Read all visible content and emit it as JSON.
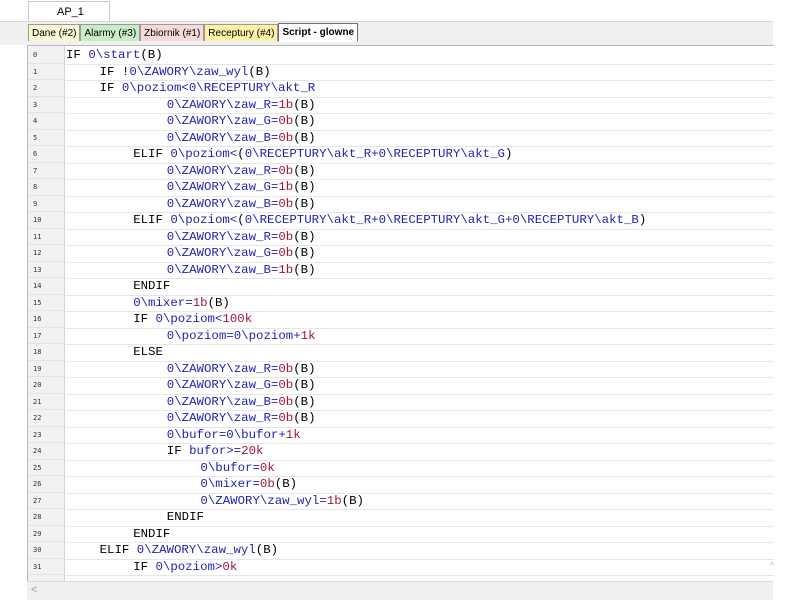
{
  "window_tab": "AP_1",
  "tabs": [
    {
      "label": "Dane (#2)",
      "color": "#f7f7d2",
      "active": false
    },
    {
      "label": "Alarmy (#3)",
      "color": "#c8ecc8",
      "active": false
    },
    {
      "label": "Zbiornik (#1)",
      "color": "#f6d9da",
      "active": false
    },
    {
      "label": "Receptury (#4)",
      "color": "#faf3a6",
      "active": false
    },
    {
      "label": "Script - glowne",
      "color": "#ffffff",
      "active": true
    }
  ],
  "colors": {
    "keyword": "#000000",
    "variable": "#1f1fb3",
    "number": "#a0153e"
  },
  "code_lines": [
    {
      "num": "0",
      "indent": 0,
      "tokens": [
        [
          "k",
          "IF "
        ],
        [
          "v",
          "0\\start"
        ],
        [
          "k",
          "(B)"
        ]
      ]
    },
    {
      "num": "1",
      "indent": 4,
      "tokens": [
        [
          "k",
          "IF "
        ],
        [
          "k",
          "!"
        ],
        [
          "v",
          "0\\ZAWORY\\zaw_wyl"
        ],
        [
          "k",
          "(B)"
        ]
      ]
    },
    {
      "num": "2",
      "indent": 4,
      "tokens": [
        [
          "k",
          "IF "
        ],
        [
          "v",
          "0\\poziom<0\\RECEPTURY\\akt_R"
        ]
      ]
    },
    {
      "num": "3",
      "indent": 12,
      "tokens": [
        [
          "v",
          "0\\ZAWORY\\zaw_R="
        ],
        [
          "n",
          "1b"
        ],
        [
          "k",
          "(B)"
        ]
      ]
    },
    {
      "num": "4",
      "indent": 12,
      "tokens": [
        [
          "v",
          "0\\ZAWORY\\zaw_G="
        ],
        [
          "n",
          "0b"
        ],
        [
          "k",
          "(B)"
        ]
      ]
    },
    {
      "num": "5",
      "indent": 12,
      "tokens": [
        [
          "v",
          "0\\ZAWORY\\zaw_B="
        ],
        [
          "n",
          "0b"
        ],
        [
          "k",
          "(B)"
        ]
      ]
    },
    {
      "num": "6",
      "indent": 8,
      "tokens": [
        [
          "k",
          "ELIF "
        ],
        [
          "v",
          "0\\poziom<"
        ],
        [
          "k",
          "("
        ],
        [
          "v",
          "0\\RECEPTURY\\akt_R+0\\RECEPTURY\\akt_G"
        ],
        [
          "k",
          ")"
        ]
      ]
    },
    {
      "num": "7",
      "indent": 12,
      "tokens": [
        [
          "v",
          "0\\ZAWORY\\zaw_R="
        ],
        [
          "n",
          "0b"
        ],
        [
          "k",
          "(B)"
        ]
      ]
    },
    {
      "num": "8",
      "indent": 12,
      "tokens": [
        [
          "v",
          "0\\ZAWORY\\zaw_G="
        ],
        [
          "n",
          "1b"
        ],
        [
          "k",
          "(B)"
        ]
      ]
    },
    {
      "num": "9",
      "indent": 12,
      "tokens": [
        [
          "v",
          "0\\ZAWORY\\zaw_B="
        ],
        [
          "n",
          "0b"
        ],
        [
          "k",
          "(B)"
        ]
      ]
    },
    {
      "num": "10",
      "indent": 8,
      "tokens": [
        [
          "k",
          "ELIF "
        ],
        [
          "v",
          "0\\poziom<"
        ],
        [
          "k",
          "("
        ],
        [
          "v",
          "0\\RECEPTURY\\akt_R+0\\RECEPTURY\\akt_G+0\\RECEPTURY\\akt_B"
        ],
        [
          "k",
          ")"
        ]
      ]
    },
    {
      "num": "11",
      "indent": 12,
      "tokens": [
        [
          "v",
          "0\\ZAWORY\\zaw_R="
        ],
        [
          "n",
          "0b"
        ],
        [
          "k",
          "(B)"
        ]
      ]
    },
    {
      "num": "12",
      "indent": 12,
      "tokens": [
        [
          "v",
          "0\\ZAWORY\\zaw_G="
        ],
        [
          "n",
          "0b"
        ],
        [
          "k",
          "(B)"
        ]
      ]
    },
    {
      "num": "13",
      "indent": 12,
      "tokens": [
        [
          "v",
          "0\\ZAWORY\\zaw_B="
        ],
        [
          "n",
          "1b"
        ],
        [
          "k",
          "(B)"
        ]
      ]
    },
    {
      "num": "14",
      "indent": 8,
      "tokens": [
        [
          "k",
          "ENDIF"
        ]
      ]
    },
    {
      "num": "15",
      "indent": 8,
      "tokens": [
        [
          "v",
          "0\\mixer="
        ],
        [
          "n",
          "1b"
        ],
        [
          "k",
          "(B)"
        ]
      ]
    },
    {
      "num": "16",
      "indent": 8,
      "tokens": [
        [
          "k",
          "IF "
        ],
        [
          "v",
          "0\\poziom<"
        ],
        [
          "n",
          "100k"
        ]
      ]
    },
    {
      "num": "17",
      "indent": 12,
      "tokens": [
        [
          "v",
          "0\\poziom=0\\poziom+"
        ],
        [
          "n",
          "1k"
        ]
      ]
    },
    {
      "num": "18",
      "indent": 8,
      "tokens": [
        [
          "k",
          "ELSE"
        ]
      ]
    },
    {
      "num": "19",
      "indent": 12,
      "tokens": [
        [
          "v",
          "0\\ZAWORY\\zaw_R="
        ],
        [
          "n",
          "0b"
        ],
        [
          "k",
          "(B)"
        ]
      ]
    },
    {
      "num": "20",
      "indent": 12,
      "tokens": [
        [
          "v",
          "0\\ZAWORY\\zaw_G="
        ],
        [
          "n",
          "0b"
        ],
        [
          "k",
          "(B)"
        ]
      ]
    },
    {
      "num": "21",
      "indent": 12,
      "tokens": [
        [
          "v",
          "0\\ZAWORY\\zaw_B="
        ],
        [
          "n",
          "0b"
        ],
        [
          "k",
          "(B)"
        ]
      ]
    },
    {
      "num": "22",
      "indent": 12,
      "tokens": [
        [
          "v",
          "0\\ZAWORY\\zaw_R="
        ],
        [
          "n",
          "0b"
        ],
        [
          "k",
          "(B)"
        ]
      ]
    },
    {
      "num": "23",
      "indent": 12,
      "tokens": [
        [
          "v",
          "0\\bufor=0\\bufor+"
        ],
        [
          "n",
          "1k"
        ]
      ]
    },
    {
      "num": "24",
      "indent": 12,
      "tokens": [
        [
          "k",
          "IF "
        ],
        [
          "v",
          "bufor>="
        ],
        [
          "n",
          "20k"
        ]
      ]
    },
    {
      "num": "25",
      "indent": 16,
      "tokens": [
        [
          "v",
          "0\\bufor="
        ],
        [
          "n",
          "0k"
        ]
      ]
    },
    {
      "num": "26",
      "indent": 16,
      "tokens": [
        [
          "v",
          "0\\mixer="
        ],
        [
          "n",
          "0b"
        ],
        [
          "k",
          "(B)"
        ]
      ]
    },
    {
      "num": "27",
      "indent": 16,
      "tokens": [
        [
          "v",
          "0\\ZAWORY\\zaw_wyl="
        ],
        [
          "n",
          "1b"
        ],
        [
          "k",
          "(B)"
        ]
      ]
    },
    {
      "num": "28",
      "indent": 12,
      "tokens": [
        [
          "k",
          "ENDIF"
        ]
      ]
    },
    {
      "num": "29",
      "indent": 8,
      "tokens": [
        [
          "k",
          "ENDIF"
        ]
      ]
    },
    {
      "num": "30",
      "indent": 4,
      "tokens": [
        [
          "k",
          "ELIF "
        ],
        [
          "v",
          "0\\ZAWORY\\zaw_wyl"
        ],
        [
          "k",
          "(B)"
        ]
      ]
    },
    {
      "num": "31",
      "indent": 8,
      "tokens": [
        [
          "k",
          "IF "
        ],
        [
          "v",
          "0\\poziom>"
        ],
        [
          "n",
          "0k"
        ]
      ]
    }
  ],
  "scroll_left_glyph": "<",
  "scroll_down_glyph": "^"
}
